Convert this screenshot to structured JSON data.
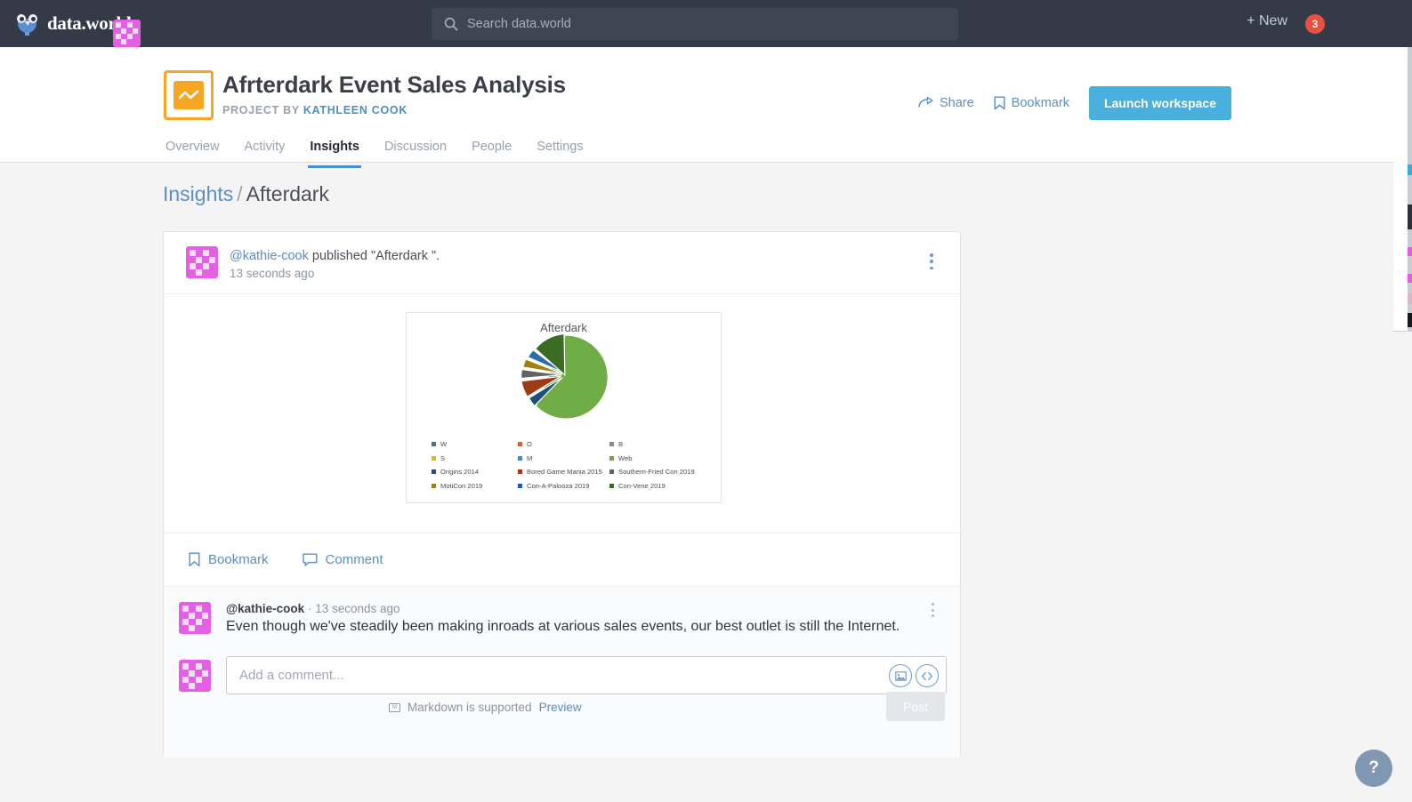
{
  "topnav": {
    "brand": "data.world",
    "brand_icon": "owl-logo-icon",
    "search_placeholder": "Search data.world",
    "search_icon": "search-icon",
    "new_label": "+ New",
    "notification_count": "3",
    "avatar_name": "user-avatar"
  },
  "project": {
    "icon": "chart-line-icon",
    "title": "Afrterdark Event Sales Analysis",
    "subtitle_prefix": "PROJECT BY ",
    "owner": "KATHLEEN COOK",
    "tabs": [
      {
        "label": "Overview",
        "active": false
      },
      {
        "label": "Activity",
        "active": false
      },
      {
        "label": "Insights",
        "active": true
      },
      {
        "label": "Discussion",
        "active": false
      },
      {
        "label": "People",
        "active": false
      },
      {
        "label": "Settings",
        "active": false
      }
    ],
    "actions": {
      "share": "Share",
      "share_icon": "share-arrow-icon",
      "bookmark": "Bookmark",
      "bookmark_icon": "bookmark-icon",
      "launch": "Launch workspace"
    }
  },
  "breadcrumb": {
    "root": "Insights",
    "separator": "/",
    "current": "Afterdark"
  },
  "insight": {
    "author": "@kathie-cook",
    "published_text": " published \"Afterdark \".",
    "time": "13 seconds ago",
    "menu_icon": "kebab-menu-icon",
    "actions": {
      "bookmark": "Bookmark",
      "bookmark_icon": "bookmark-icon",
      "comment": "Comment",
      "comment_icon": "comment-bubble-icon"
    }
  },
  "comment": {
    "author": "@kathie-cook",
    "dot": "·",
    "time": "13 seconds ago",
    "body": "Even though we've steadily been making inroads at various sales events, our best outlet is still the Internet.",
    "menu_icon": "kebab-menu-icon"
  },
  "compose": {
    "placeholder": "Add a comment...",
    "image_icon": "insert-image-icon",
    "code_icon": "insert-code-icon",
    "markdown_note": "Markdown is supported",
    "markdown_icon": "markdown-icon",
    "preview": "Preview",
    "post": "Post"
  },
  "help": {
    "label": "?",
    "icon": "question-mark-icon"
  },
  "chart_data": {
    "type": "pie",
    "title": "Afterdark",
    "categories": [
      "W",
      "O",
      "B",
      "S",
      "M",
      "Web",
      "Origins 2014",
      "Bored Game Mania 2015",
      "Southern-Fried Con 2019",
      "MotiCon 2019",
      "Con-A-Palooza 2019",
      "Con-Vene 2019"
    ],
    "legend_colors": [
      "#4472a8",
      "#d8622a",
      "#8a8a8a",
      "#e8b31c",
      "#3c8fcc",
      "#6aa844",
      "#2b4b7d",
      "#9e3a16",
      "#636363",
      "#9d8212",
      "#1f5fa0",
      "#3b6b24"
    ],
    "legend_position": "bottom",
    "legend_columns": 3,
    "slices": [
      {
        "label": "Web",
        "value": 62.0,
        "color": "#70ad47"
      },
      {
        "label": "Origins 2014",
        "value": 3.5,
        "color": "#1f4e79"
      },
      {
        "label": "Bored Game Mania 2015",
        "value": 12.5,
        "color": "#9e3a16"
      },
      {
        "label": "Southern-Fried Con 2019",
        "value": 5.5,
        "color": "#636363"
      },
      {
        "label": "MotiCon 2019",
        "value": 4.0,
        "color": "#9d8212"
      },
      {
        "label": "Con-A-Palooza 2019",
        "value": 4.0,
        "color": "#2c6ca8"
      },
      {
        "label": "Con-Vene 2019",
        "value": 8.5,
        "color": "#3b6b24"
      }
    ],
    "xlabel": "",
    "ylabel": ""
  }
}
